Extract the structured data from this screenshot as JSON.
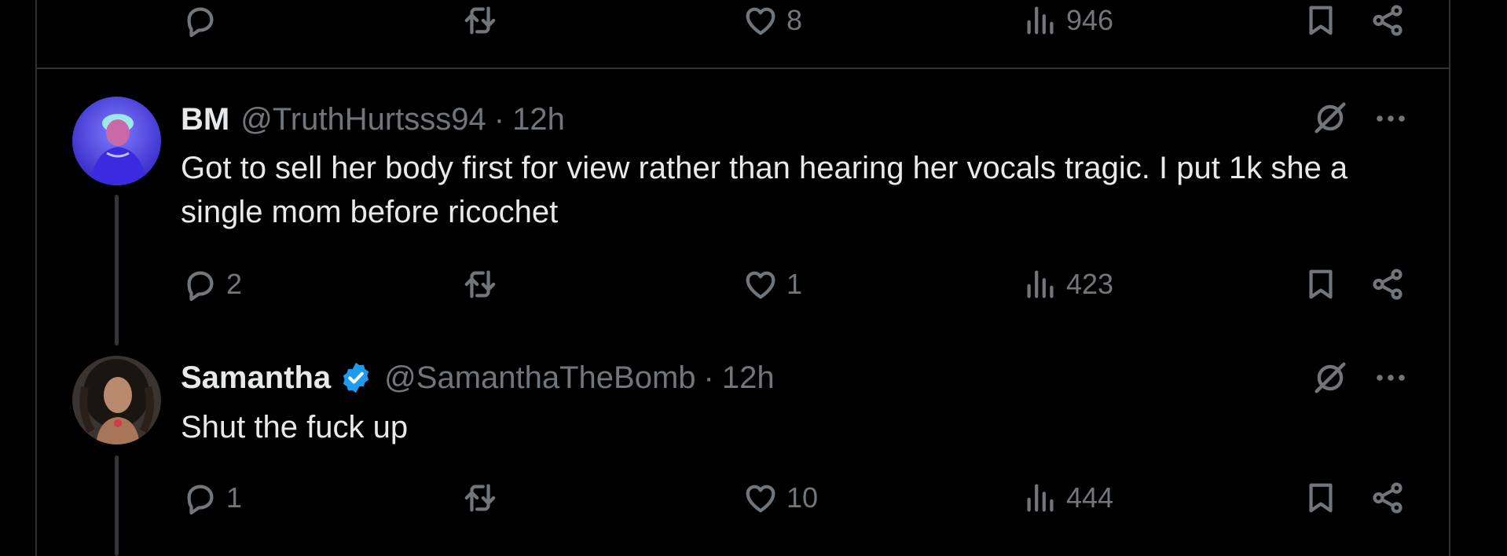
{
  "top_tweet": {
    "actions": {
      "reply_count": "",
      "retweet_count": "",
      "like_count": "8",
      "view_count": "946"
    }
  },
  "tweets": [
    {
      "name": "BM",
      "handle": "@TruthHurtsss94",
      "dot": "·",
      "time": "12h",
      "verified": false,
      "text": "Got to sell her body first for view rather than hearing her vocals tragic. I put 1k she a single mom before ricochet",
      "actions": {
        "reply_count": "2",
        "retweet_count": "",
        "like_count": "1",
        "view_count": "423"
      }
    },
    {
      "name": "Samantha",
      "handle": "@SamanthaTheBomb",
      "dot": "·",
      "time": "12h",
      "verified": true,
      "text": "Shut the fuck up",
      "actions": {
        "reply_count": "1",
        "retweet_count": "",
        "like_count": "10",
        "view_count": "444"
      }
    }
  ],
  "colors": {
    "background": "#000000",
    "text": "#e7e9ea",
    "muted": "#71767b",
    "border": "#2f3336",
    "verified": "#1d9bf0"
  },
  "icons": [
    "reply-icon",
    "retweet-icon",
    "like-icon",
    "views-icon",
    "bookmark-icon",
    "share-icon",
    "grok-icon",
    "more-icon",
    "verified-badge-icon"
  ]
}
